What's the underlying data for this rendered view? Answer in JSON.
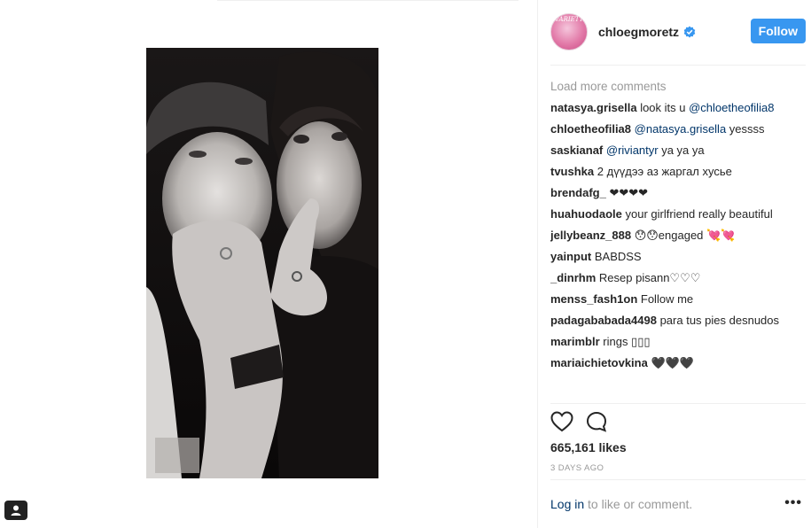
{
  "post": {
    "username": "chloegmoretz",
    "avatar_text": "VARIETY",
    "follow_label": "Follow",
    "verified_icon": "verified-badge-icon",
    "load_more": "Load more comments",
    "comments": [
      {
        "user": "natasya.grisella",
        "text": "look its u ",
        "mention": "@chloetheofilia8",
        "after": ""
      },
      {
        "user": "chloetheofilia8",
        "text": "",
        "mention": "@natasya.grisella",
        "after": " yessss"
      },
      {
        "user": "saskianaf",
        "text": "",
        "mention": "@riviantyr",
        "after": " ya ya ya"
      },
      {
        "user": "tvushka",
        "text": "2 дүүдээ аз жаргал хусье",
        "mention": "",
        "after": ""
      },
      {
        "user": "brendafg_",
        "text": "❤❤❤❤",
        "mention": "",
        "after": ""
      },
      {
        "user": "huahuodaole",
        "text": "your girlfriend really beautiful",
        "mention": "",
        "after": ""
      },
      {
        "user": "jellybeanz_888",
        "text": "😯😯engaged 💘💘",
        "mention": "",
        "after": ""
      },
      {
        "user": "yainput",
        "text": "BABDSS",
        "mention": "",
        "after": ""
      },
      {
        "user": "_dinrhm",
        "text": "Resep pisann♡♡♡",
        "mention": "",
        "after": ""
      },
      {
        "user": "menss_fash1on",
        "text": "Follow me",
        "mention": "",
        "after": ""
      },
      {
        "user": "padagababada4498",
        "text": "para tus pies desnudos",
        "mention": "",
        "after": ""
      },
      {
        "user": "marimblr",
        "text": "rings ▯▯▯",
        "mention": "",
        "after": ""
      },
      {
        "user": "mariaichietovkina",
        "text": "🖤🖤🖤",
        "mention": "",
        "after": ""
      }
    ],
    "likes": "665,161 likes",
    "time": "3 DAYS AGO",
    "login_link": "Log in",
    "login_text": " to like or comment.",
    "more_options": "•••",
    "icons": {
      "like": "heart-icon",
      "comment": "comment-icon",
      "user_tag": "user-tag-icon"
    }
  },
  "colors": {
    "accent": "#3897f0",
    "link": "#003569",
    "muted": "#999999",
    "text": "#262626"
  }
}
